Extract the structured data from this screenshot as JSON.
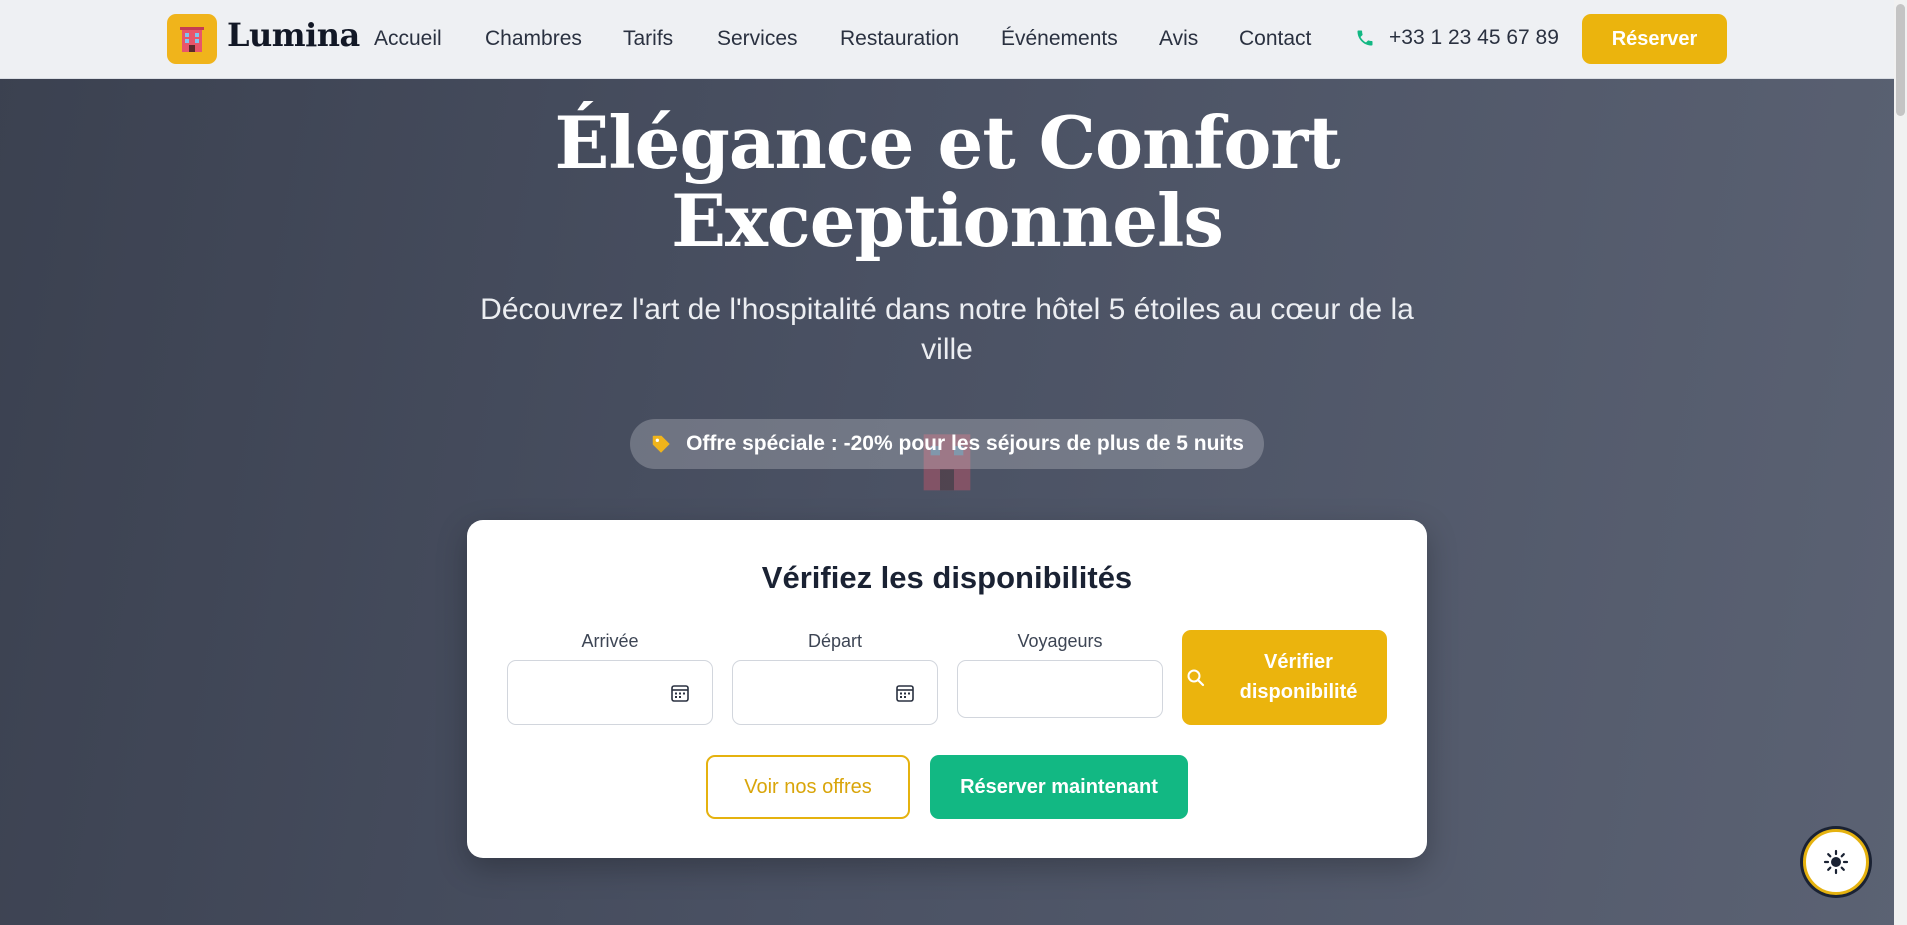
{
  "header": {
    "brand": "Lumina",
    "logo_icon": "hotel-icon",
    "nav": [
      {
        "label": "Accueil"
      },
      {
        "label": "Chambres"
      },
      {
        "label": "Tarifs"
      },
      {
        "label": "Services"
      },
      {
        "label": "Restauration"
      },
      {
        "label": "Événements"
      },
      {
        "label": "Avis"
      },
      {
        "label": "Contact"
      }
    ],
    "phone": "+33 1 23 45 67 89",
    "reserve_label": "Réserver"
  },
  "hero": {
    "title_line1": "Élégance et Confort",
    "title_line2": "Exceptionnels",
    "subtitle": "Découvrez l'art de l'hospitalité dans notre hôtel 5 étoiles au cœur de la ville",
    "offer": "Offre spéciale : -20% pour les séjours de plus de 5 nuits"
  },
  "booking": {
    "title": "Vérifiez les disponibilités",
    "arrival_label": "Arrivée",
    "arrival_value": "",
    "departure_label": "Départ",
    "departure_value": "",
    "guests_label": "Voyageurs",
    "guests_value": "",
    "verify_line1": "Vérifier",
    "verify_line2": "disponibilité",
    "offers_label": "Voir nos offres",
    "book_now_label": "Réserver maintenant"
  },
  "colors": {
    "accent": "#ebb40d",
    "green": "#12b883",
    "dark": "#1a2233"
  }
}
